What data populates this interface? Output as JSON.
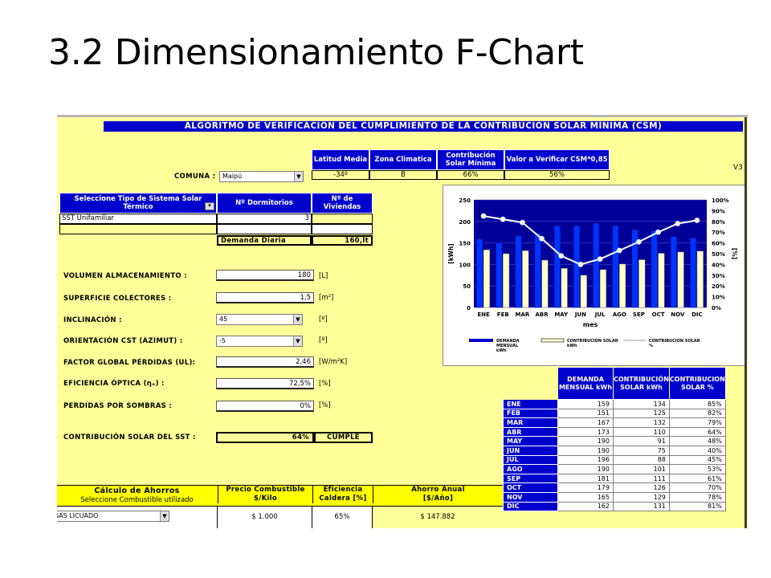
{
  "slide": {
    "title": "3.2 Dimensionamiento F-Chart"
  },
  "sheet": {
    "header": "ALGORITMO DE VERIFICACIÓN DEL CUMPLIMIENTO DE LA CONTRIBUCIÓN SOLAR MÍNIMA (CSM)",
    "version": "V3",
    "comuna_label": "COMUNA :",
    "comuna_value": "Maipú",
    "summary_headers": [
      "Latitud Media",
      "Zona Climatica",
      "Contribución Solar Mínima",
      "Valor a Verificar CSM*0,85"
    ],
    "summary_values": [
      "-34º",
      "B",
      "66%",
      "56%"
    ],
    "system_headers": [
      "Seleccione Tipo de Sistema Solar Térmico",
      "Nº Dormitorios",
      "Nº de Viviendas"
    ],
    "system_type": "SST Unifamiliar",
    "dormitorios": "3",
    "demanda_label": "Demanda Diaria",
    "demanda_value": "160,lt",
    "params": [
      {
        "label": "VOLUMEN ALMACENAMIENTO :",
        "value": "180",
        "unit": "[L]"
      },
      {
        "label": "SUPERFICIE COLECTORES :",
        "value": "1,5",
        "unit": "[m²]"
      },
      {
        "label": "INCLINACIÓN :",
        "value": "45",
        "unit": "[º]"
      },
      {
        "label": "ORIENTACIÓN CST (AZIMUT) :",
        "value": "-5",
        "unit": "[º]"
      },
      {
        "label": "FACTOR GLOBAL PÉRDIDAS (UL):",
        "value": "2,46",
        "unit": "[W/m²K]"
      },
      {
        "label": "EFICIENCIA ÓPTICA (ηₒ) :",
        "value": "72,5%",
        "unit": "[%]"
      },
      {
        "label": "PERDIDAS POR SOMBRAS :",
        "value": "0%",
        "unit": "[%]"
      }
    ],
    "contrib_label": "CONTRIBUCIÓN SOLAR DEL SST :",
    "contrib_value": "64%",
    "contrib_status": "CUMPLE",
    "savings": {
      "title": "Cálculo de Ahorros",
      "subtitle": "Seleccione Combustible utilizado",
      "fuel": "GAS LICUADO",
      "price_header": "Precio Combustible $/Kilo",
      "eff_header": "Eficiencia Caldera [%]",
      "annual_header": "Ahorro Anual [$/Año]",
      "price": "$ 1.000",
      "efficiency": "65%",
      "annual": "$ 147.882"
    },
    "table": {
      "headers": [
        "DEMANDA MENSUAL kWh",
        "CONTRIBUCIÓN SOLAR kWh",
        "CONTRIBUCION SOLAR %"
      ],
      "rows": [
        [
          "ENE",
          "159",
          "134",
          "85%"
        ],
        [
          "FEB",
          "151",
          "125",
          "82%"
        ],
        [
          "MAR",
          "167",
          "132",
          "79%"
        ],
        [
          "ABR",
          "173",
          "110",
          "64%"
        ],
        [
          "MAY",
          "190",
          "91",
          "48%"
        ],
        [
          "JUN",
          "190",
          "75",
          "40%"
        ],
        [
          "JUL",
          "196",
          "88",
          "45%"
        ],
        [
          "AGO",
          "190",
          "101",
          "53%"
        ],
        [
          "SEP",
          "181",
          "111",
          "61%"
        ],
        [
          "OCT",
          "179",
          "126",
          "70%"
        ],
        [
          "NOV",
          "165",
          "129",
          "78%"
        ],
        [
          "DIC",
          "162",
          "131",
          "81%"
        ]
      ]
    }
  },
  "chart_data": {
    "type": "bar",
    "categories": [
      "ENE",
      "FEB",
      "MAR",
      "ABR",
      "MAY",
      "JUN",
      "JUL",
      "AGO",
      "SEP",
      "OCT",
      "NOV",
      "DIC"
    ],
    "series": [
      {
        "name": "DEMANDA MENSUAL kWh",
        "type": "bar",
        "color": "#0000cc",
        "values": [
          159,
          151,
          167,
          173,
          190,
          190,
          196,
          190,
          181,
          179,
          165,
          162
        ]
      },
      {
        "name": "CONTRIBUCIÓN SOLAR kWh",
        "type": "bar",
        "color": "#ffffcc",
        "values": [
          134,
          125,
          132,
          110,
          91,
          75,
          88,
          101,
          111,
          126,
          129,
          131
        ]
      },
      {
        "name": "CONTRIBUCION SOLAR %",
        "type": "line",
        "axis": "right",
        "color": "#ffffff",
        "values": [
          85,
          82,
          79,
          64,
          48,
          40,
          45,
          53,
          61,
          70,
          78,
          81
        ]
      }
    ],
    "xlabel": "mes",
    "ylabel": "[kWh]",
    "ylabel_right": "[%]",
    "ylim": [
      0,
      250
    ],
    "yticks": [
      0,
      50,
      100,
      150,
      200,
      250
    ],
    "ylim_right": [
      0,
      100
    ],
    "yticks_right": [
      "0%",
      "10%",
      "20%",
      "30%",
      "40%",
      "50%",
      "60%",
      "70%",
      "80%",
      "90%",
      "100%"
    ],
    "background": "#000099",
    "legend": "bottom"
  }
}
